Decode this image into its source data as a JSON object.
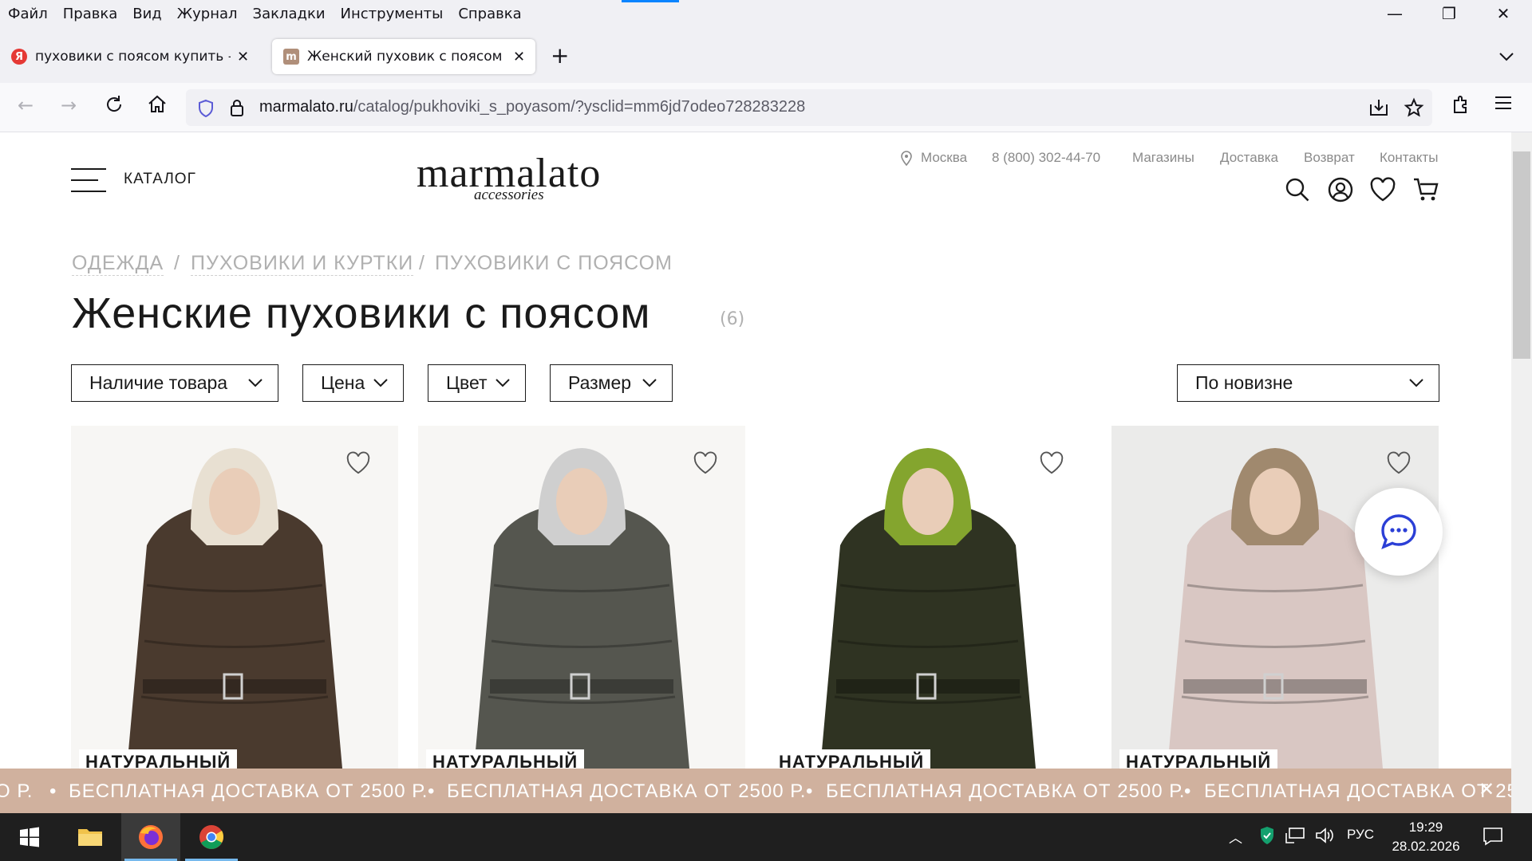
{
  "menu": [
    "Файл",
    "Правка",
    "Вид",
    "Журнал",
    "Закладки",
    "Инструменты",
    "Справка"
  ],
  "tabs": [
    {
      "title": "пуховики с поясом купить — Я",
      "favicon": "Я",
      "active": false
    },
    {
      "title": "Женский пуховик с поясом купить",
      "favicon": "m",
      "active": true
    }
  ],
  "address": {
    "host": "marmalato.ru",
    "path": "/catalog/pukhoviki_s_poyasom/?ysclid=mm6jd7odeo728283228"
  },
  "site": {
    "catalog_label": "КАТАЛОГ",
    "logo": "marmalato",
    "logo_sub": "accessories",
    "city": "Москва",
    "phone": "8 (800) 302-44-70",
    "links": [
      "Магазины",
      "Доставка",
      "Возврат",
      "Контакты"
    ]
  },
  "breadcrumbs": [
    "ОДЕЖДА",
    "/",
    "ПУХОВИКИ И КУРТКИ",
    "/",
    "ПУХОВИКИ С ПОЯСОМ"
  ],
  "heading": "Женские пуховики с поясом",
  "count": "(6)",
  "filters": [
    "Наличие товара",
    "Цена",
    "Цвет",
    "Размер"
  ],
  "sort": "По новизне",
  "products": [
    {
      "label": "НАТУРАЛЬНЫЙ",
      "coat": "#4a3a2e",
      "hood": "#e8e0d2",
      "bg": "#f7f6f4"
    },
    {
      "label": "НАТУРАЛЬНЫЙ",
      "coat": "#55564f",
      "hood": "#cfcfcf",
      "bg": "#f7f6f4"
    },
    {
      "label": "НАТУРАЛЬНЫЙ",
      "coat": "#2f3322",
      "hood": "#84a52e",
      "bg": "#ffffff"
    },
    {
      "label": "НАТУРАЛЬНЫЙ",
      "coat": "#d9c7c3",
      "hood": "#a0896e",
      "bg": "#ebebea"
    }
  ],
  "promo_text": "БЕСПЛАТНАЯ ДОСТАВКА ОТ 2500 Р.",
  "promo_fragment": "О Р.",
  "taskbar": {
    "lang": "РУС",
    "time": "19:29",
    "date": "28.02.2026"
  }
}
